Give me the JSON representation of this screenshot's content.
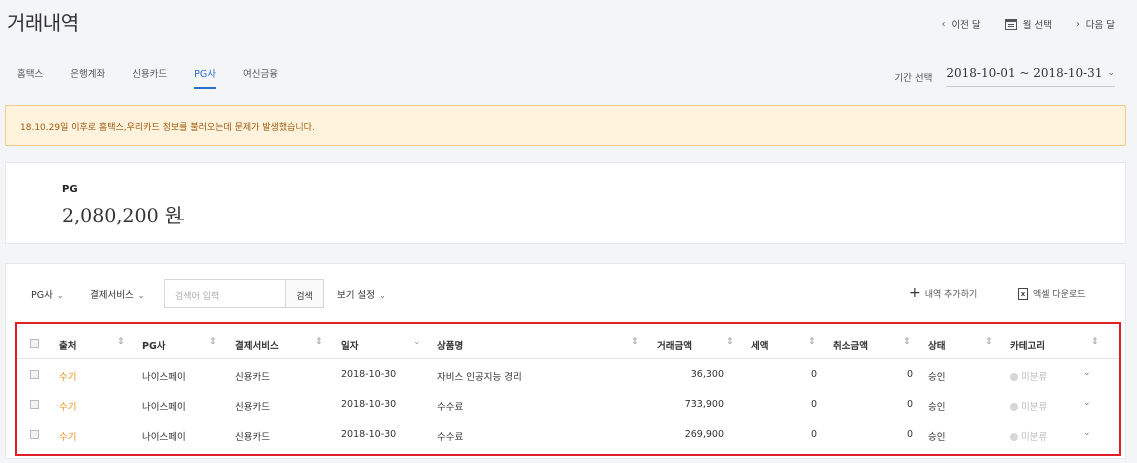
{
  "header": {
    "title": "거래내역",
    "prev_month": "이전 달",
    "month_select": "월 선택",
    "next_month": "다음 달"
  },
  "tabs": [
    {
      "label": "홈택스",
      "active": false
    },
    {
      "label": "은행계좌",
      "active": false
    },
    {
      "label": "신용카드",
      "active": false
    },
    {
      "label": "PG사",
      "active": true
    },
    {
      "label": "여신금융",
      "active": false
    }
  ],
  "period": {
    "label": "기간 선택",
    "value": "2018-10-01 ~ 2018-10-31"
  },
  "alert": {
    "message": "18.10.29일 이후로 홈택스,우리카드 정보를 불러오는데 문제가 발생했습니다."
  },
  "summary": {
    "label": "PG",
    "amount": "2,080,200 원"
  },
  "toolbar": {
    "pg_filter": "PG사",
    "service_filter": "결제서비스",
    "search_placeholder": "검색어 입력",
    "search_button": "검색",
    "view_settings": "보기 설정",
    "add_entry": "내역 추가하기",
    "excel_download": "엑셀 다운로드"
  },
  "table": {
    "columns": [
      "출처",
      "PG사",
      "결제서비스",
      "일자",
      "상품명",
      "거래금액",
      "세액",
      "취소금액",
      "상태",
      "카테고리"
    ],
    "rows": [
      {
        "source": "수기",
        "pg": "나이스페이",
        "service": "신용카드",
        "date": "2018-10-30",
        "product": "자비스 인공지능 경리",
        "amount": "36,300",
        "tax": "0",
        "cancel": "0",
        "status": "승인",
        "category": "미분류"
      },
      {
        "source": "수기",
        "pg": "나이스페이",
        "service": "신용카드",
        "date": "2018-10-30",
        "product": "수수료",
        "amount": "733,900",
        "tax": "0",
        "cancel": "0",
        "status": "승인",
        "category": "미분류"
      },
      {
        "source": "수기",
        "pg": "나이스페이",
        "service": "신용카드",
        "date": "2018-10-30",
        "product": "수수료",
        "amount": "269,900",
        "tax": "0",
        "cancel": "0",
        "status": "승인",
        "category": "미분류"
      }
    ]
  },
  "icons": {
    "prev": "chevron-left-icon",
    "calendar": "calendar-icon",
    "next": "chevron-right-icon",
    "sort": "sort-icon",
    "excel": "excel-icon",
    "plus": "plus-icon"
  },
  "colors": {
    "accent": "#2b6fcf",
    "alert_bg": "#fdf2dc",
    "alert_text": "#a05a10",
    "source_link": "#e8921c",
    "highlight_border": "#e01e25"
  }
}
